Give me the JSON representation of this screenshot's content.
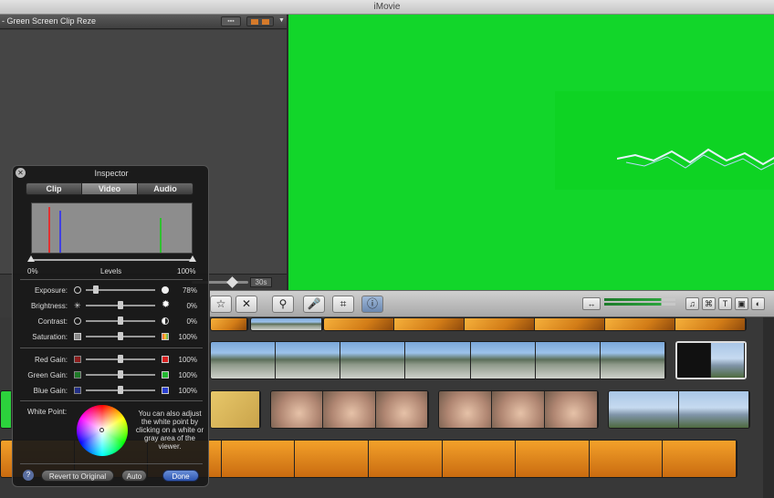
{
  "app": {
    "title": "iMovie"
  },
  "event_browser": {
    "title": "- Green Screen Clip Reze",
    "view_btn": "▪▪▪",
    "duration": "30s"
  },
  "inspector": {
    "title": "Inspector",
    "tabs": [
      "Clip",
      "Video",
      "Audio"
    ],
    "active_tab": "Video",
    "levels": {
      "label": "Levels",
      "min": "0%",
      "max": "100%"
    },
    "adjustments": [
      {
        "label": "Exposure:",
        "value": "78%",
        "level": 0.15
      },
      {
        "label": "Brightness:",
        "value": "0%",
        "level": 0.5
      },
      {
        "label": "Contrast:",
        "value": "0%",
        "level": 0.5
      },
      {
        "label": "Saturation:",
        "value": "100%",
        "level": 0.5
      }
    ],
    "gains": [
      {
        "label": "Red Gain:",
        "value": "100%",
        "color": "#d82020",
        "level": 0.5
      },
      {
        "label": "Green Gain:",
        "value": "100%",
        "color": "#22b830",
        "level": 0.5
      },
      {
        "label": "Blue Gain:",
        "value": "100%",
        "color": "#2a3fd0",
        "level": 0.5
      }
    ],
    "white_point": {
      "label": "White Point:",
      "help": "You can also adjust the white point by clicking on a white or gray area of the viewer."
    },
    "buttons": {
      "help": "?",
      "revert": "Revert to Original",
      "auto": "Auto",
      "done": "Done"
    }
  },
  "toolbar": {
    "favorite": "☆",
    "reject": "✕",
    "keyword": "⚲",
    "voiceover": "🎤",
    "crop": "⌗",
    "inspector": "ⓘ",
    "right": [
      "♫",
      "⌘",
      "T",
      "▣",
      "◐"
    ]
  }
}
